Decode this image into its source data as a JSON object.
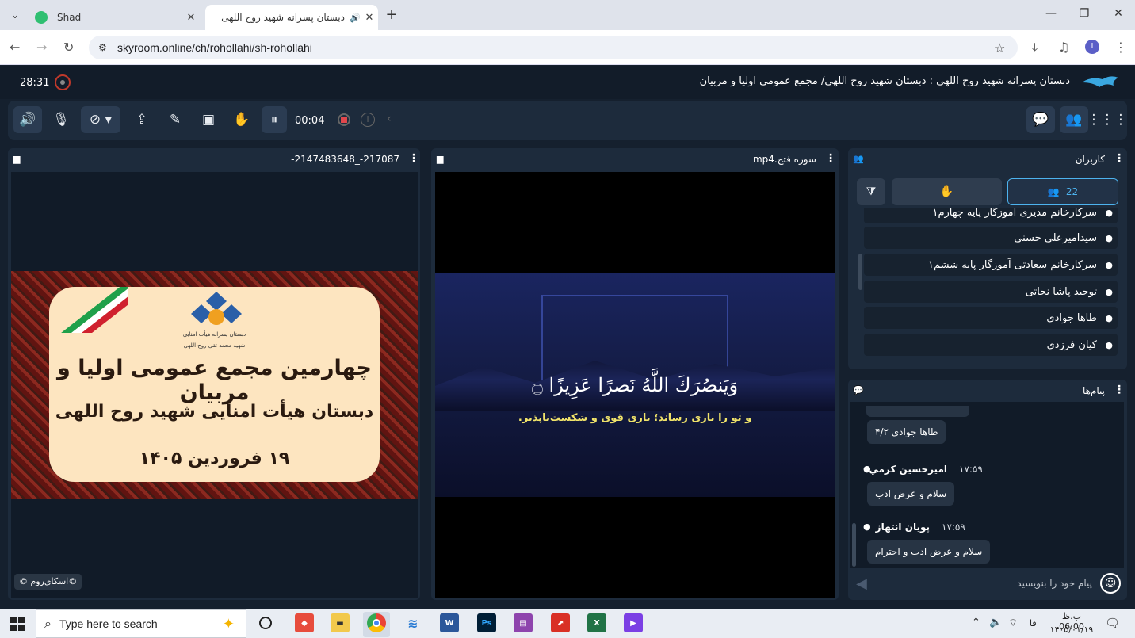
{
  "browser": {
    "tabs": [
      {
        "title": "Shad",
        "active": false
      },
      {
        "title": "دبستان پسرانه شهید روح اللهی",
        "active": true
      }
    ],
    "new_tab": "+",
    "close": "✕",
    "url": "skyroom.online/ch/rohollahi/sh-rohollahi",
    "window_controls": {
      "minimize": "—",
      "maximize": "❐",
      "close": "✕"
    },
    "profile_initial": "I"
  },
  "app": {
    "clock": "28:31",
    "room_title": "دبستان پسرانه شهید روح اللهی : دبستان شهید روح اللهی/ مجمع عمومی اولیا و مربیان",
    "timer": "00:04",
    "accent": "#4db3ee"
  },
  "panels": {
    "presentation": {
      "title": "217087-_2147483648-",
      "slide": {
        "school_line1": "دبستان پسرانه هیأت امنایی",
        "school_line2": "شهید محمد تقی روح اللهی",
        "headline": "چهارمین مجمع عمومی اولیا و مربیان",
        "subline": "دبستان هیأت امنایی شهید روح اللهی",
        "date": "۱۹ فروردین ۱۴۰۵"
      },
      "watermark": "©اسکای‌روم ©"
    },
    "video": {
      "title": "سوره فتح.mp4",
      "ayah": "وَیَنصُرَكَ اللَّهُ نَصرًا عَزِیزًا ۝",
      "translation": "و تو را یاری رساند؛ یاری قوی و شکست‌ناپذیر."
    },
    "users": {
      "title": "کاربران",
      "count": "22",
      "rows": [
        "سرکارخانم مدیری آموزگار پایه چهارم۱",
        "سیدامیرعلي حسني",
        "سرکارخانم سعادتی آموزگار پایه ششم۱",
        "توحید پاشا نجاتی",
        "طاها جوادي",
        "کیان فرزدي"
      ]
    },
    "messages": {
      "title": "پیام‌ها",
      "items": [
        {
          "name": "",
          "time": "",
          "text": "طاها جوادی ۴/۲"
        },
        {
          "name": "امیرحسین کرمي",
          "time": "۱۷:۵۹",
          "text": "سلام و عرض ادب"
        },
        {
          "name": "پویان انتهاز",
          "time": "۱۷:۵۹",
          "text": "سلام و عرض ادب و احترام"
        }
      ],
      "input_placeholder": "پیام خود را بنویسید"
    }
  },
  "taskbar": {
    "search_placeholder": "Type here to search",
    "lang": "فا",
    "time": "ب.ظ 06:00",
    "date": "۱۴۰۵/۰۱/۱۹"
  }
}
